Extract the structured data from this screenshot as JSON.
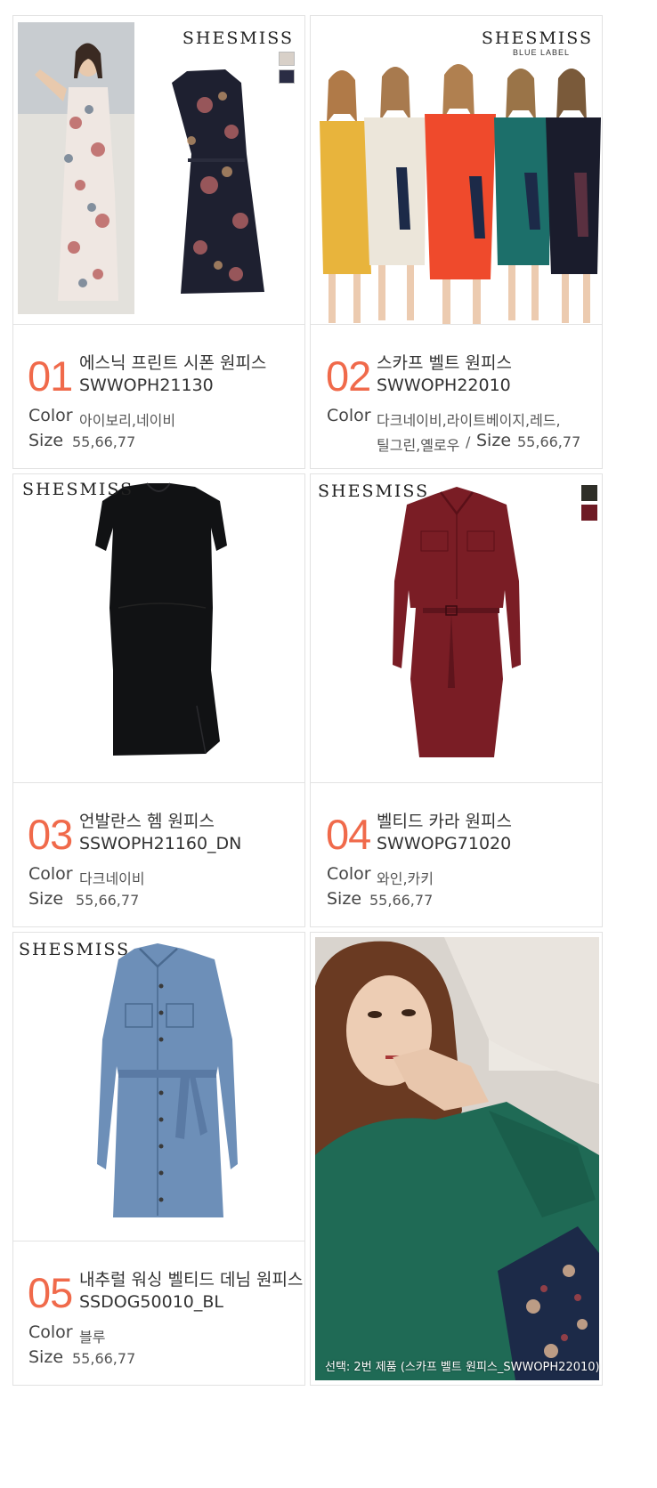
{
  "brand": {
    "logo": "SHESMISS",
    "sub_label": "BLUE LABEL"
  },
  "labels": {
    "color": "Color",
    "size": "Size"
  },
  "products": [
    {
      "number": "01",
      "name": "에스닉 프린트 시폰 원피스",
      "code": "SWWOPH21130",
      "colors": "아이보리,네이비",
      "sizes": "55,66,77"
    },
    {
      "number": "02",
      "name": "스카프 벨트 원피스",
      "code": "SWWOPH22010",
      "colors": "다크네이비,라이트베이지,레드,",
      "colors_line2": "틸그린,옐로우",
      "size_inline_sep": "/",
      "sizes": "55,66,77"
    },
    {
      "number": "03",
      "name": "언발란스 헴 원피스",
      "code": "SSWOPH21160_DN",
      "colors": "다크네이비",
      "sizes": "55,66,77"
    },
    {
      "number": "04",
      "name": "벨티드 카라 원피스",
      "code": "SWWOPG71020",
      "colors": "와인,카키",
      "sizes": "55,66,77"
    },
    {
      "number": "05",
      "name": "내추럴 워싱 벨티드 데님 원피스",
      "code": "SSDOG50010_BL",
      "colors": "블루",
      "sizes": "55,66,77"
    }
  ],
  "model_photo": {
    "caption": "선택: 2번 제품 (스카프 벨트 원피스_SWWOPH22010)"
  },
  "colors": {
    "accent_number": "#f06a4b",
    "swatch_khaki": "#2f2f28",
    "swatch_wine": "#6e1a24",
    "dress_red": "#ef4a2c",
    "dress_yellow": "#e8b43c",
    "dress_beige": "#ece6da",
    "dress_teal": "#1c6f6a",
    "dress_navy": "#1a1c2c",
    "denim": "#6d8fb8",
    "model_teal": "#1f6a55"
  }
}
